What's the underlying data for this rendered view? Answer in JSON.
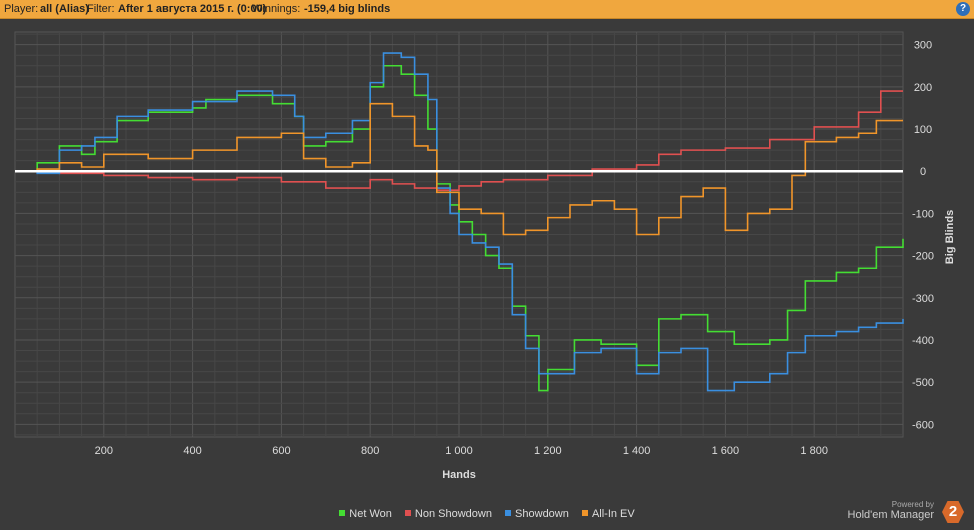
{
  "header": {
    "player_label": "Player:",
    "player_value": "all (Alias)",
    "filter_label": "Filter:",
    "filter_value": "After 1 августа 2015 г. (0:00)",
    "winnings_label": "Winnings:",
    "winnings_value": "-159,4 big blinds",
    "help_icon": "?"
  },
  "branding": {
    "powered_by": "Powered by",
    "product": "Hold'em Manager",
    "logo_text": "2"
  },
  "colors": {
    "net_won": "#44dd33",
    "non_showdown": "#e05050",
    "showdown": "#3a8fe0",
    "allin_ev": "#f0952a"
  },
  "chart_data": {
    "type": "line",
    "xlabel": "Hands",
    "ylabel": "Big Blinds",
    "xlim": [
      0,
      2000
    ],
    "ylim": [
      -630,
      330
    ],
    "x_ticks": [
      200,
      400,
      600,
      800,
      1000,
      1200,
      1400,
      1600,
      1800
    ],
    "x_tick_labels": [
      "200",
      "400",
      "600",
      "800",
      "1 000",
      "1 200",
      "1 400",
      "1 600",
      "1 800"
    ],
    "y_ticks": [
      300,
      200,
      100,
      0,
      -100,
      -200,
      -300,
      -400,
      -500,
      -600
    ],
    "y_tick_labels": [
      "300",
      "200",
      "100",
      "0",
      "-100",
      "-200",
      "-300",
      "-400",
      "-500",
      "-600"
    ],
    "grid": true,
    "legend_position": "bottom",
    "series": [
      {
        "name": "Net Won",
        "color": "#44dd33",
        "points": [
          [
            0,
            0
          ],
          [
            50,
            20
          ],
          [
            100,
            60
          ],
          [
            150,
            40
          ],
          [
            180,
            70
          ],
          [
            230,
            120
          ],
          [
            300,
            140
          ],
          [
            400,
            150
          ],
          [
            430,
            170
          ],
          [
            500,
            180
          ],
          [
            580,
            160
          ],
          [
            630,
            130
          ],
          [
            650,
            60
          ],
          [
            700,
            70
          ],
          [
            760,
            100
          ],
          [
            800,
            200
          ],
          [
            830,
            250
          ],
          [
            870,
            230
          ],
          [
            900,
            180
          ],
          [
            930,
            100
          ],
          [
            950,
            -30
          ],
          [
            980,
            -80
          ],
          [
            1000,
            -120
          ],
          [
            1030,
            -150
          ],
          [
            1060,
            -200
          ],
          [
            1090,
            -230
          ],
          [
            1120,
            -320
          ],
          [
            1150,
            -390
          ],
          [
            1180,
            -520
          ],
          [
            1200,
            -470
          ],
          [
            1260,
            -400
          ],
          [
            1320,
            -410
          ],
          [
            1400,
            -460
          ],
          [
            1450,
            -350
          ],
          [
            1500,
            -340
          ],
          [
            1560,
            -380
          ],
          [
            1620,
            -410
          ],
          [
            1700,
            -400
          ],
          [
            1740,
            -330
          ],
          [
            1780,
            -260
          ],
          [
            1850,
            -240
          ],
          [
            1900,
            -230
          ],
          [
            1940,
            -180
          ],
          [
            2000,
            -160
          ]
        ]
      },
      {
        "name": "Non Showdown",
        "color": "#e05050",
        "points": [
          [
            0,
            0
          ],
          [
            100,
            -5
          ],
          [
            200,
            -10
          ],
          [
            300,
            -15
          ],
          [
            400,
            -20
          ],
          [
            500,
            -15
          ],
          [
            600,
            -25
          ],
          [
            700,
            -40
          ],
          [
            800,
            -20
          ],
          [
            850,
            -30
          ],
          [
            900,
            -40
          ],
          [
            950,
            -45
          ],
          [
            1000,
            -35
          ],
          [
            1050,
            -25
          ],
          [
            1100,
            -20
          ],
          [
            1200,
            -10
          ],
          [
            1300,
            5
          ],
          [
            1400,
            15
          ],
          [
            1450,
            40
          ],
          [
            1500,
            50
          ],
          [
            1600,
            55
          ],
          [
            1700,
            75
          ],
          [
            1800,
            105
          ],
          [
            1900,
            140
          ],
          [
            1950,
            190
          ],
          [
            2000,
            190
          ]
        ]
      },
      {
        "name": "Showdown",
        "color": "#3a8fe0",
        "points": [
          [
            0,
            0
          ],
          [
            50,
            -5
          ],
          [
            100,
            50
          ],
          [
            150,
            60
          ],
          [
            180,
            80
          ],
          [
            230,
            130
          ],
          [
            300,
            145
          ],
          [
            400,
            165
          ],
          [
            500,
            190
          ],
          [
            580,
            180
          ],
          [
            630,
            130
          ],
          [
            650,
            80
          ],
          [
            700,
            90
          ],
          [
            760,
            120
          ],
          [
            800,
            210
          ],
          [
            830,
            280
          ],
          [
            870,
            270
          ],
          [
            900,
            230
          ],
          [
            930,
            170
          ],
          [
            950,
            -40
          ],
          [
            980,
            -100
          ],
          [
            1000,
            -150
          ],
          [
            1030,
            -170
          ],
          [
            1060,
            -180
          ],
          [
            1090,
            -220
          ],
          [
            1120,
            -340
          ],
          [
            1150,
            -420
          ],
          [
            1180,
            -480
          ],
          [
            1260,
            -430
          ],
          [
            1320,
            -420
          ],
          [
            1400,
            -480
          ],
          [
            1450,
            -430
          ],
          [
            1500,
            -420
          ],
          [
            1560,
            -520
          ],
          [
            1620,
            -500
          ],
          [
            1700,
            -480
          ],
          [
            1740,
            -430
          ],
          [
            1780,
            -390
          ],
          [
            1850,
            -380
          ],
          [
            1900,
            -370
          ],
          [
            1940,
            -360
          ],
          [
            2000,
            -350
          ]
        ]
      },
      {
        "name": "All-In EV",
        "color": "#f0952a",
        "points": [
          [
            0,
            0
          ],
          [
            50,
            5
          ],
          [
            100,
            20
          ],
          [
            150,
            10
          ],
          [
            200,
            40
          ],
          [
            300,
            30
          ],
          [
            400,
            50
          ],
          [
            500,
            80
          ],
          [
            600,
            90
          ],
          [
            650,
            30
          ],
          [
            700,
            10
          ],
          [
            760,
            20
          ],
          [
            800,
            160
          ],
          [
            850,
            130
          ],
          [
            900,
            60
          ],
          [
            930,
            50
          ],
          [
            950,
            -50
          ],
          [
            1000,
            -90
          ],
          [
            1050,
            -100
          ],
          [
            1100,
            -150
          ],
          [
            1150,
            -140
          ],
          [
            1200,
            -110
          ],
          [
            1250,
            -80
          ],
          [
            1300,
            -70
          ],
          [
            1350,
            -90
          ],
          [
            1400,
            -150
          ],
          [
            1450,
            -110
          ],
          [
            1500,
            -60
          ],
          [
            1550,
            -40
          ],
          [
            1600,
            -140
          ],
          [
            1650,
            -100
          ],
          [
            1700,
            -90
          ],
          [
            1750,
            -10
          ],
          [
            1780,
            70
          ],
          [
            1850,
            80
          ],
          [
            1900,
            90
          ],
          [
            1940,
            120
          ],
          [
            2000,
            120
          ]
        ]
      }
    ]
  }
}
